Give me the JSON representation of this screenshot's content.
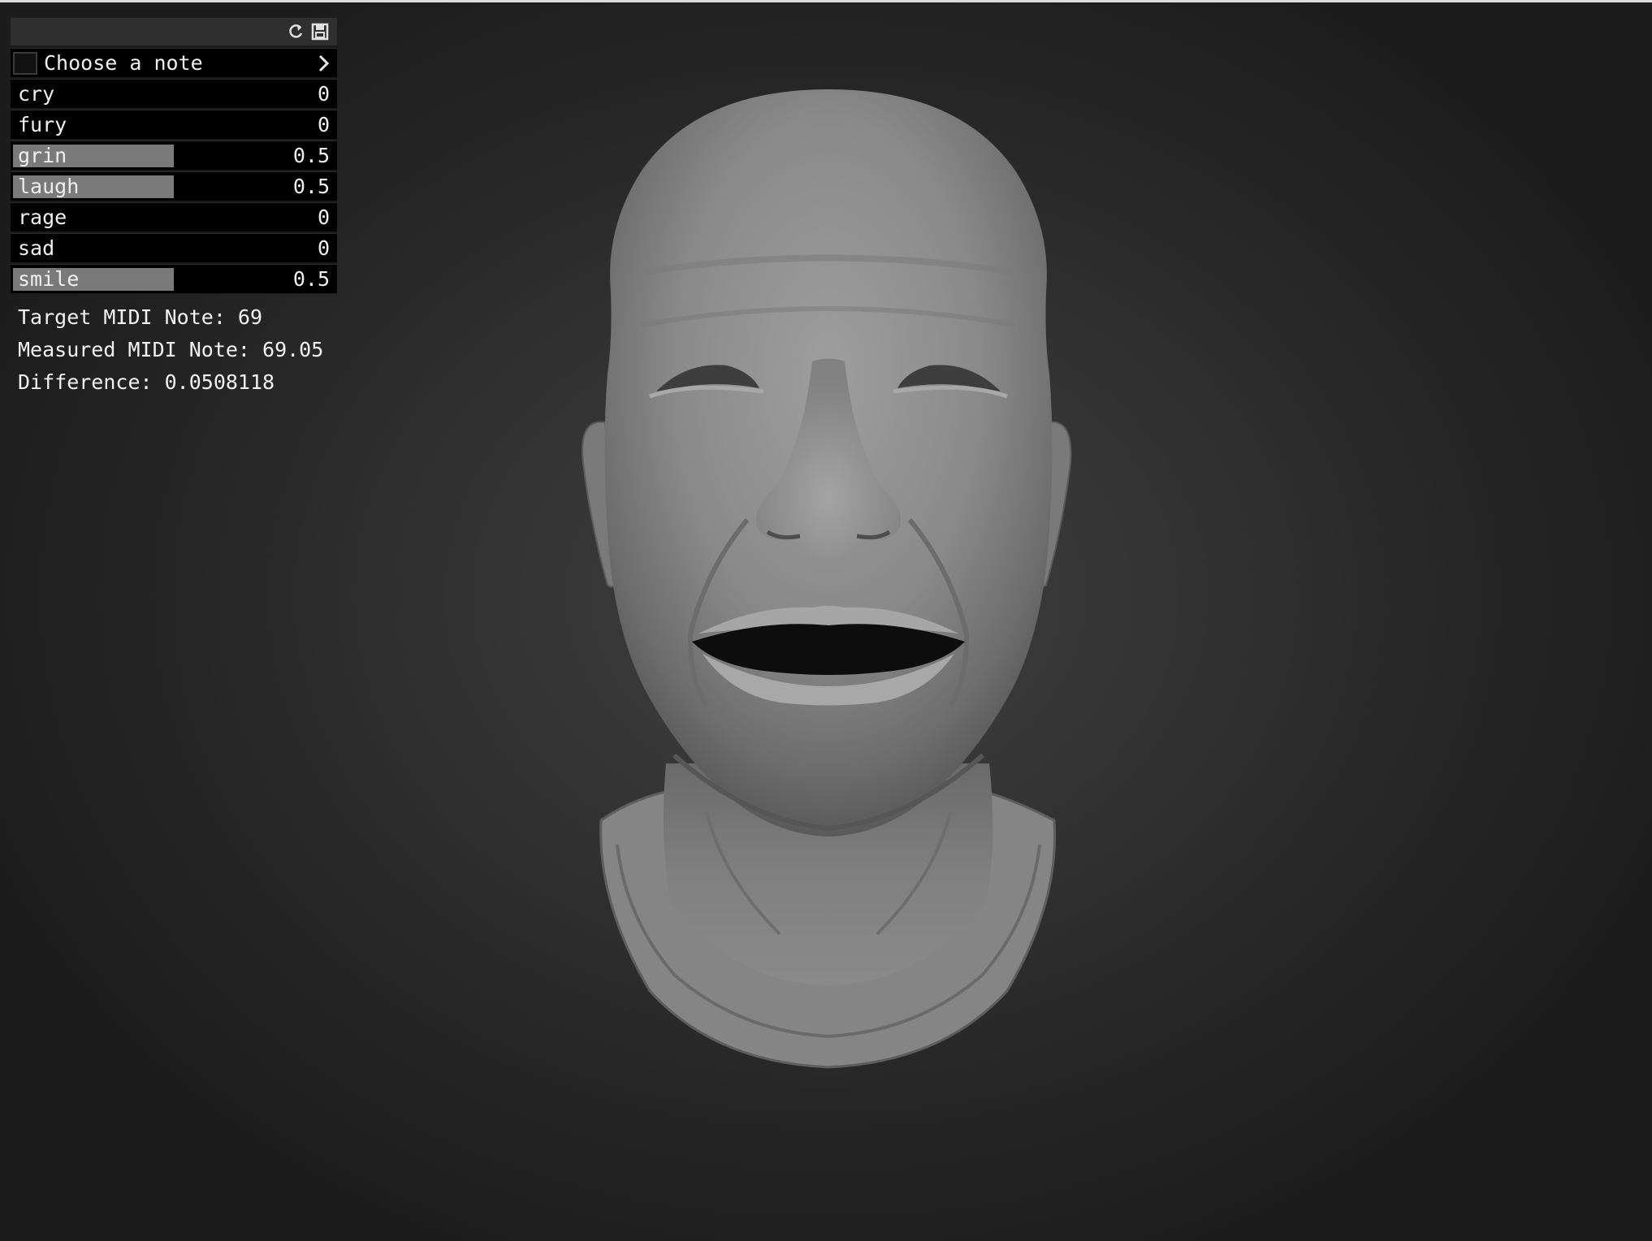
{
  "panel": {
    "header_icons": [
      "refresh-icon",
      "save-icon"
    ],
    "note_selector": {
      "label": "Choose a note",
      "checked": false,
      "icon": "chevron-right-icon"
    },
    "sliders": [
      {
        "label": "cry",
        "value": "0",
        "fraction": 0
      },
      {
        "label": "fury",
        "value": "0",
        "fraction": 0
      },
      {
        "label": "grin",
        "value": "0.5",
        "fraction": 0.5
      },
      {
        "label": "laugh",
        "value": "0.5",
        "fraction": 0.5
      },
      {
        "label": "rage",
        "value": "0",
        "fraction": 0
      },
      {
        "label": "sad",
        "value": "0",
        "fraction": 0
      },
      {
        "label": "smile",
        "value": "0.5",
        "fraction": 0.5
      }
    ],
    "slider_fill_color": "#7a7a7a"
  },
  "info": {
    "target": "Target MIDI Note: 69",
    "measured": "Measured MIDI Note: 69.05",
    "difference": "Difference: 0.0508118"
  },
  "viewport": {
    "model": "bald human head bust with open-mouth smiling expression",
    "background_color": "#2a2a2a",
    "model_color": "#8a8a8a"
  }
}
